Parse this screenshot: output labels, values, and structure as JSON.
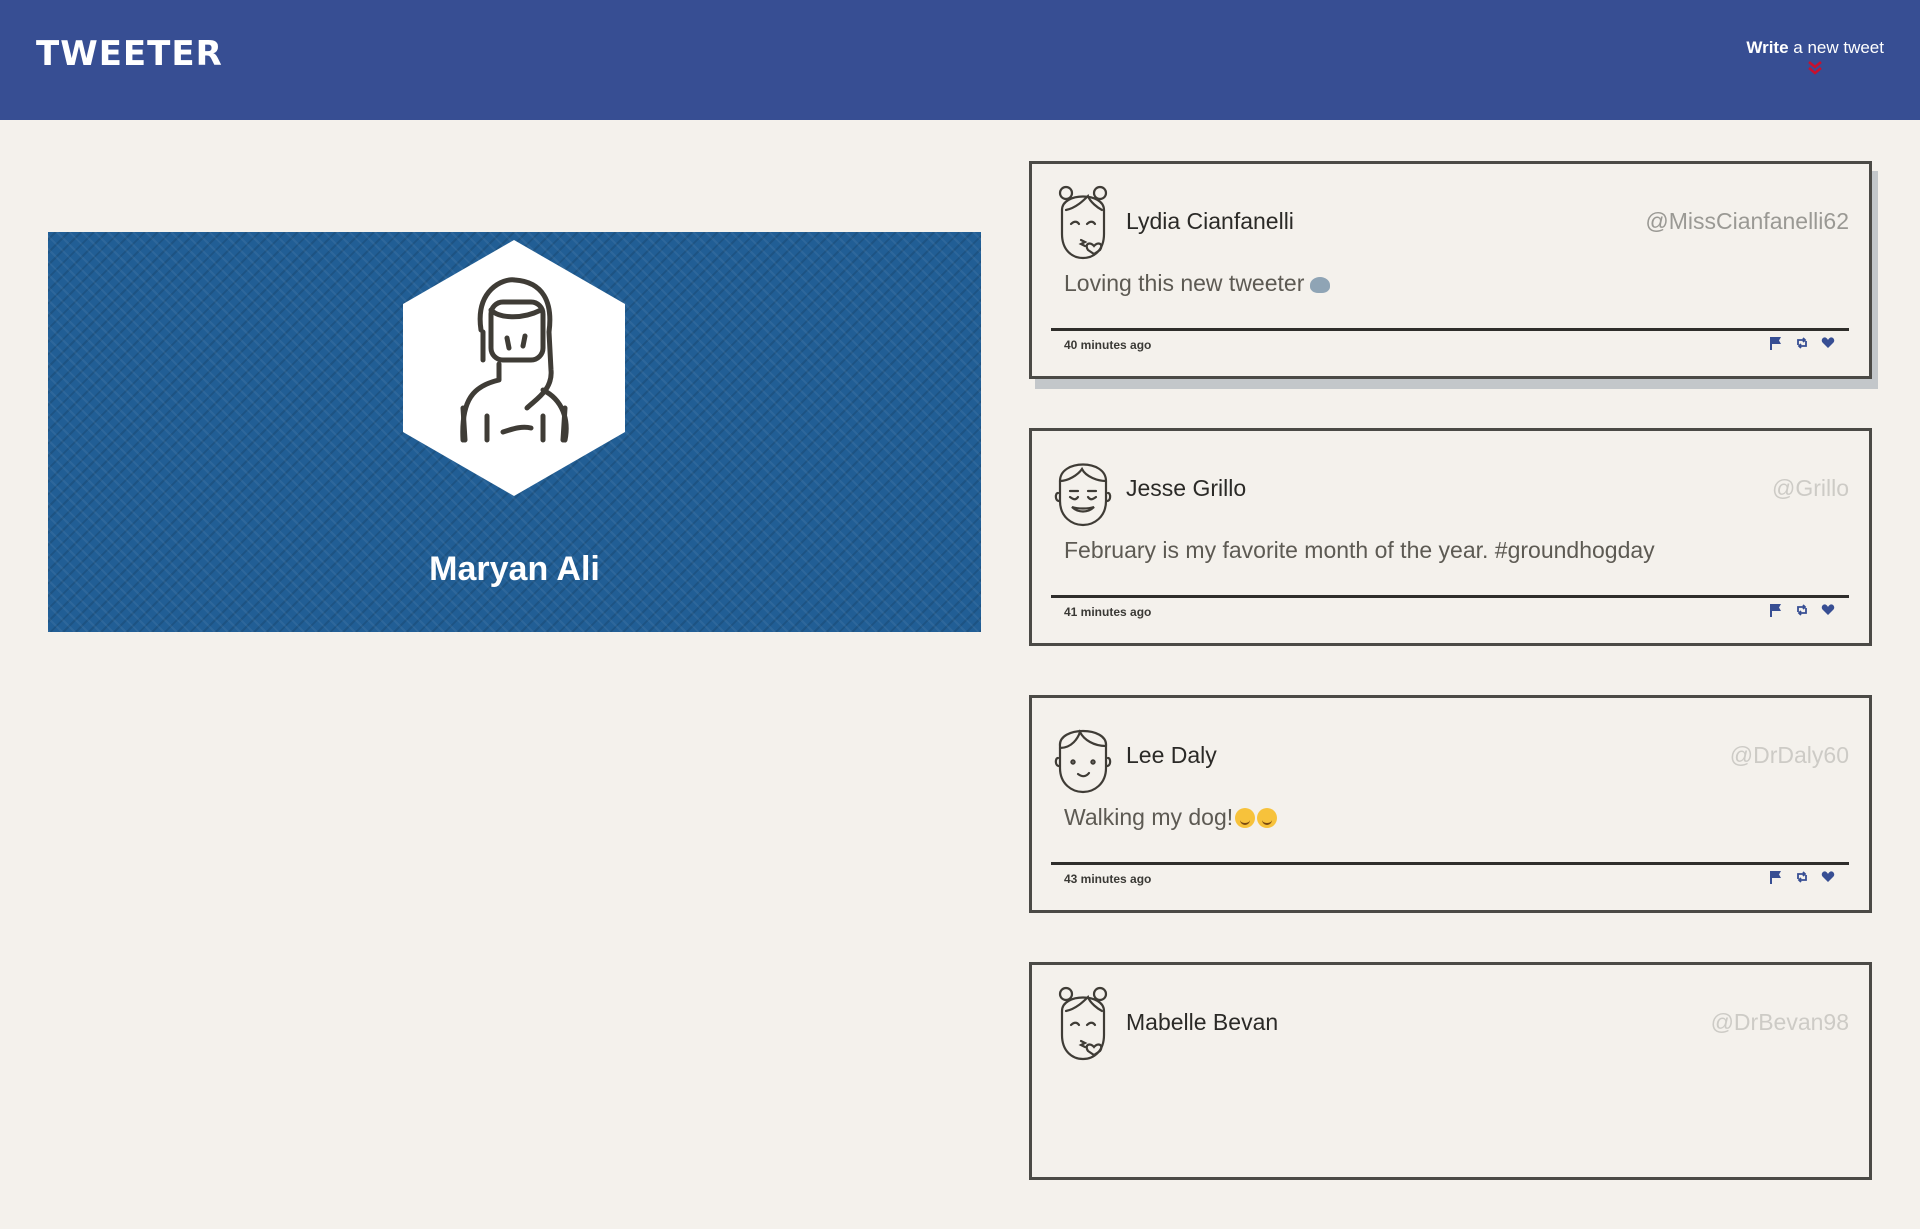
{
  "nav": {
    "brand": "TWEETER",
    "compose_bold": "Write",
    "compose_rest": " a new tweet",
    "compose_icon": "double-chevron-down-icon",
    "compose_icon_color": "#c8102e"
  },
  "profile": {
    "name": "Maryan Ali",
    "avatar_icon": "woman-avatar-icon"
  },
  "colors": {
    "nav": "#374e93",
    "page": "#f4f1ec",
    "profile_bg": "#215e95",
    "action_icons": "#374e93"
  },
  "tweets": [
    {
      "name": "Lydia Cianfanelli",
      "handle": "@MissCianfanelli62",
      "text": "Loving this new tweeter",
      "time": "40 minutes ago",
      "avatar_icon": "girl-kiss-avatar-icon"
    },
    {
      "name": "Jesse Grillo",
      "handle": "@Grillo",
      "text": "February is my favorite month of the year. #groundhogday",
      "time": "41 minutes ago",
      "avatar_icon": "man-smile-avatar-icon"
    },
    {
      "name": "Lee Daly",
      "handle": "@DrDaly60",
      "text": "Walking my dog!",
      "time": "43 minutes ago",
      "avatar_icon": "boy-avatar-icon"
    },
    {
      "name": "Mabelle Bevan",
      "handle": "@DrBevan98",
      "text": "",
      "time": "",
      "avatar_icon": "girl-kiss-avatar-icon"
    }
  ],
  "tweet_actions": [
    "flag-icon",
    "retweet-icon",
    "heart-icon"
  ]
}
